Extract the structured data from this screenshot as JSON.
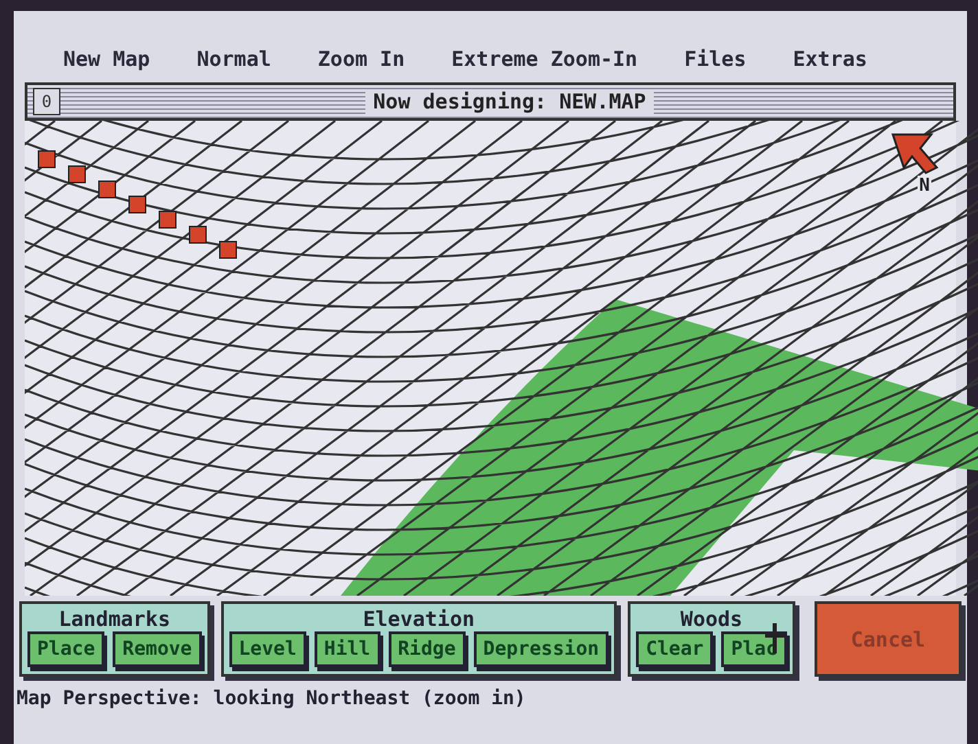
{
  "menu": [
    "New Map",
    "Normal",
    "Zoom In",
    "Extreme Zoom-In",
    "Files",
    "Extras"
  ],
  "window": {
    "close_box": "0",
    "title": "Now designing: NEW.MAP"
  },
  "compass_label": "N",
  "tool_groups": [
    {
      "title": "Landmarks",
      "buttons": [
        "Place",
        "Remove"
      ]
    },
    {
      "title": "Elevation",
      "buttons": [
        "Level",
        "Hill",
        "Ridge",
        "Depression"
      ]
    },
    {
      "title": "Woods",
      "buttons": [
        "Clear",
        "Plac"
      ]
    }
  ],
  "cancel_button": "Cancel",
  "status_bar": "Map Perspective: looking Northeast (zoom in)"
}
